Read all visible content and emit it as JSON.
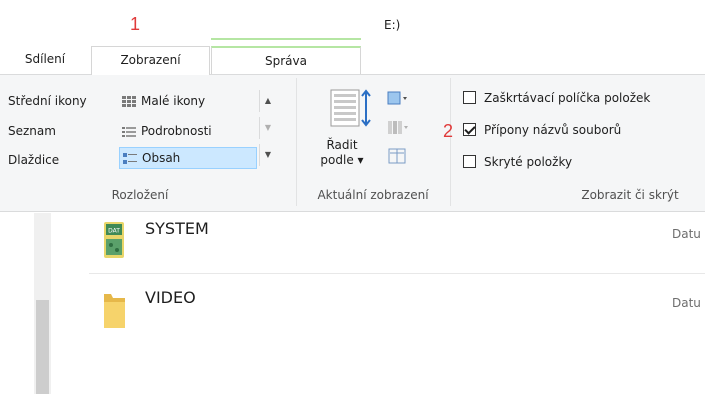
{
  "window": {
    "title_fragment": "E:)"
  },
  "annotations": {
    "marker_1": "1",
    "marker_2": "2",
    "color": "#e03a3a"
  },
  "tabs": {
    "share": "Sdílení",
    "view": "Zobrazení",
    "manage": "Správa"
  },
  "ribbon": {
    "layout": {
      "items": {
        "medium_icons": "Střední ikony",
        "small_icons": "Malé ikony",
        "list": "Seznam",
        "details": "Podrobnosti",
        "tiles": "Dlaždice",
        "content": "Obsah"
      },
      "selected": "Obsah",
      "label": "Rozložení"
    },
    "current_view": {
      "sort_line1": "Řadit",
      "sort_line2": "podle",
      "label": "Aktuální zobrazení"
    },
    "show_hide": {
      "item_checkboxes": {
        "label": "Zaškrtávací políčka položek",
        "checked": false
      },
      "file_name_extensions": {
        "label": "Přípony názvů souborů",
        "checked": true
      },
      "hidden_items": {
        "label": "Skryté položky",
        "checked": false
      },
      "label": "Zobrazit či skrýt"
    }
  },
  "files": [
    {
      "name": "SYSTEM",
      "icon": "dat-file-icon",
      "meta": "Datu"
    },
    {
      "name": "VIDEO",
      "icon": "folder-icon",
      "meta": "Datu"
    }
  ]
}
